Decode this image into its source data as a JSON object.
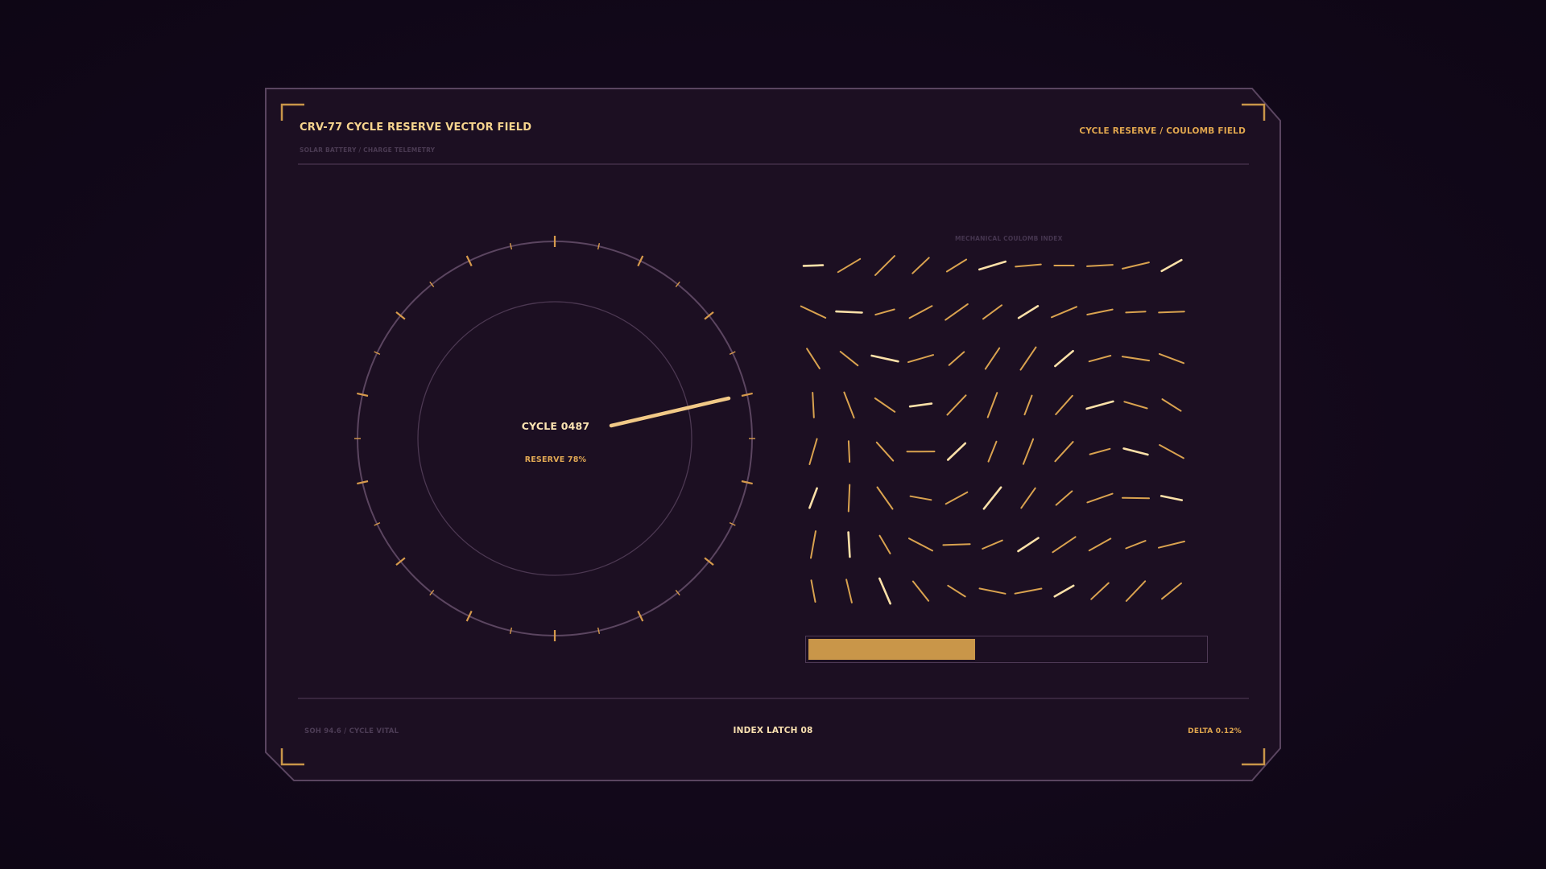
{
  "header": {
    "title": "CRV-77  CYCLE RESERVE VECTOR FIELD",
    "subtitle": "SOLAR BATTERY / CHARGE TELEMETRY",
    "right_label": "CYCLE RESERVE / COULOMB FIELD"
  },
  "gauge": {
    "cycle_label": "CYCLE 0487",
    "reserve_label": "RESERVE 78%",
    "reserve_fraction": 0.78
  },
  "vector_field": {
    "label": "MECHANICAL COULOMB INDEX",
    "rows": 8,
    "cols": 11
  },
  "progress": {
    "fraction": 0.42
  },
  "footer": {
    "left": "SOH 94.6 / CYCLE VITAL",
    "center": "INDEX LATCH 08",
    "right": "DELTA 0.12%"
  },
  "colors": {
    "background": "#12081a",
    "panel": "#1c0f22",
    "panel_border": "#5a4560",
    "accent": "#e0a64e",
    "accent_light": "#f6d48e",
    "muted": "#4a3a52"
  }
}
